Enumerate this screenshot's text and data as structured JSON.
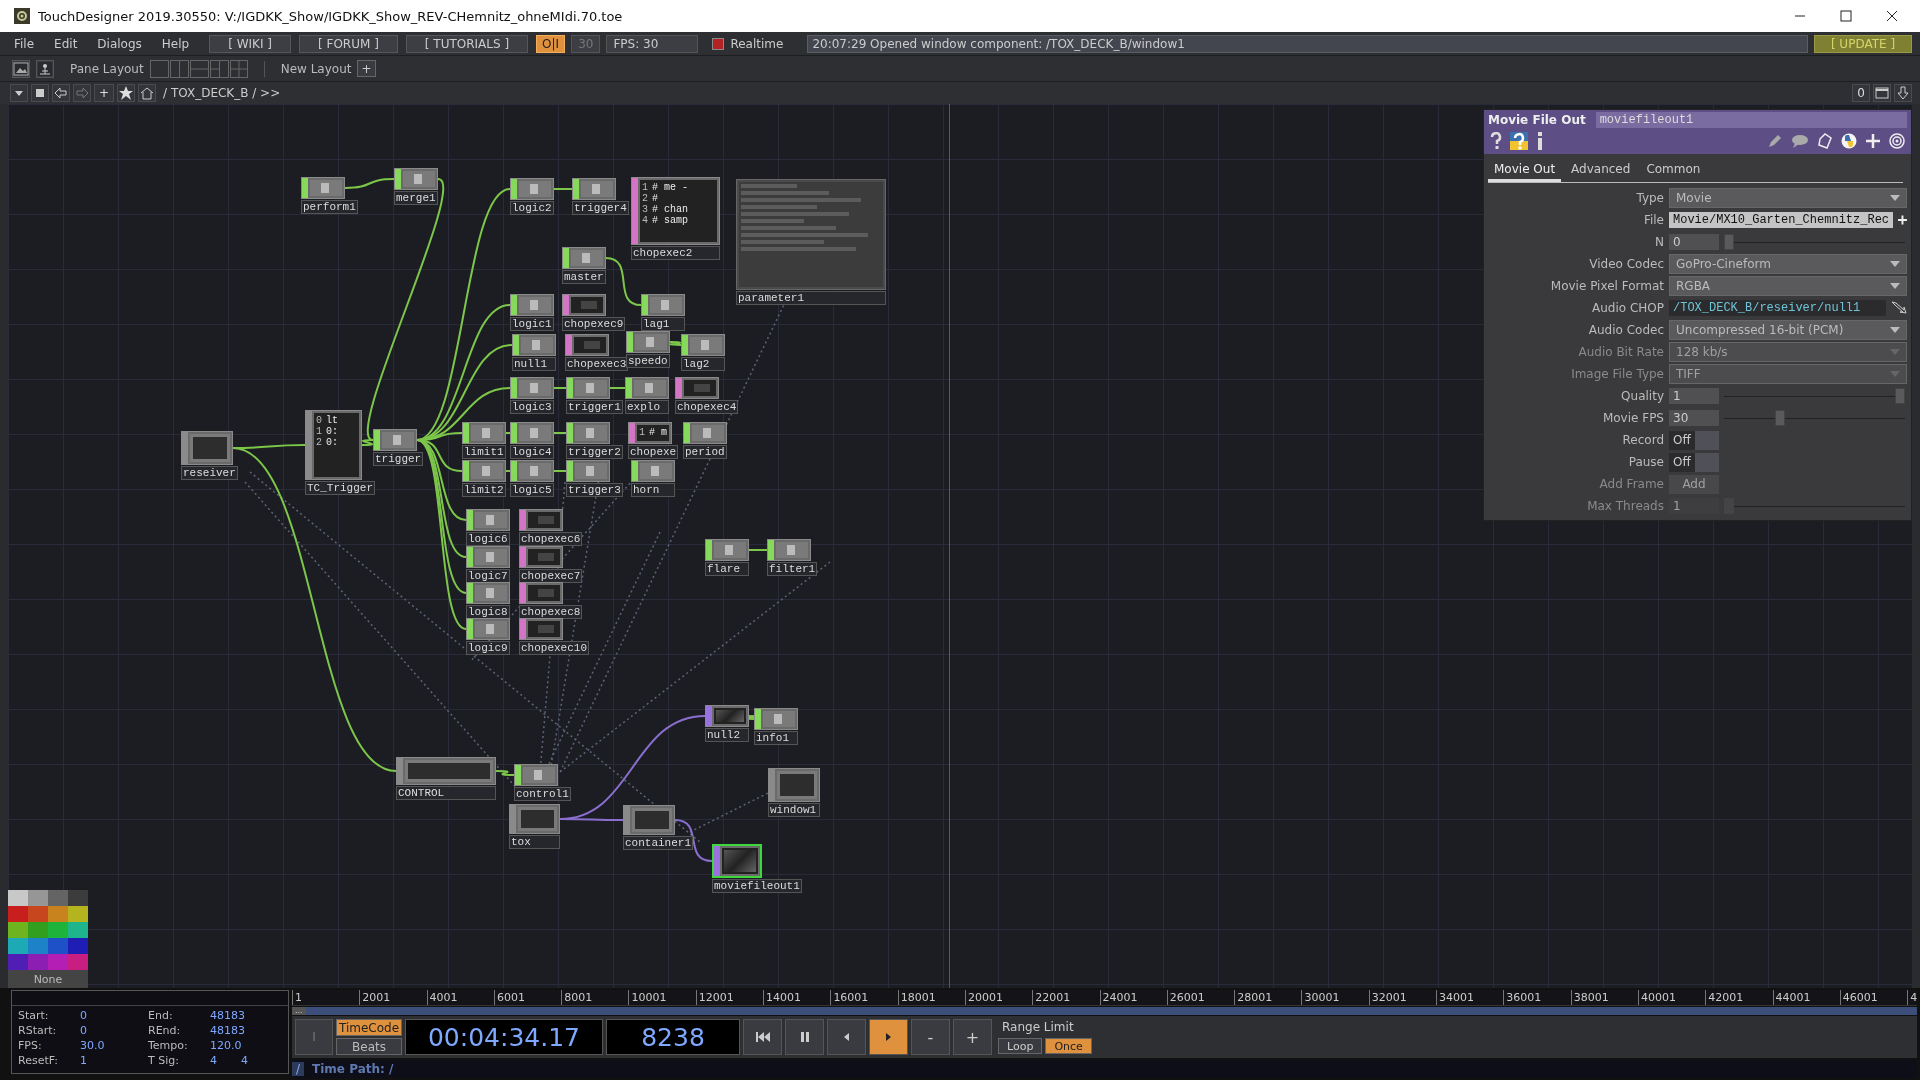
{
  "window": {
    "title": "TouchDesigner 2019.30550: V:/IGDKK_Show/IGDKK_Show_REV-CHemnitz_ohneMIdi.70.toe"
  },
  "menu": [
    "File",
    "Edit",
    "Dialogs",
    "Help"
  ],
  "links": [
    "[ WIKI ]",
    "[ FORUM ]",
    "[ TUTORIALS ]"
  ],
  "toolbar": {
    "perform": {
      "label": "O|I",
      "on": true
    },
    "fps_limit": "30",
    "fps": "FPS:  30",
    "realtime": {
      "label": "Realtime",
      "on": true
    },
    "message": "20:07:29 Opened window component: /TOX_DECK_B/window1",
    "update": "[ UPDATE ]"
  },
  "pane_bar": {
    "label": "Pane Layout",
    "new_layout": "New Layout",
    "add": "+"
  },
  "path_bar": {
    "add": "+",
    "path": "/ TOX_DECK_B / >>",
    "count": "0"
  },
  "nodes": [
    {
      "name": "perform1",
      "kind": "chop",
      "selected": false
    },
    {
      "name": "merge1",
      "kind": "chop",
      "selected": false
    },
    {
      "name": "logic2",
      "kind": "chop",
      "selected": false
    },
    {
      "name": "trigger4",
      "kind": "chop",
      "selected": false
    },
    {
      "name": "chopexec2",
      "kind": "dat",
      "selected": false,
      "lines": [
        {
          "num": "1",
          "text": "# me -"
        },
        {
          "num": "2",
          "text": "#"
        },
        {
          "num": "3",
          "text": "# chan"
        },
        {
          "num": "4",
          "text": "# samp"
        }
      ]
    },
    {
      "name": "parameter1",
      "kind": "panel",
      "selected": false
    },
    {
      "name": "master",
      "kind": "chop",
      "selected": false
    },
    {
      "name": "logic1",
      "kind": "chop",
      "selected": false
    },
    {
      "name": "chopexec9",
      "kind": "dat",
      "selected": false
    },
    {
      "name": "lag1",
      "kind": "chop",
      "selected": false
    },
    {
      "name": "null1",
      "kind": "chop",
      "selected": false
    },
    {
      "name": "chopexec3",
      "kind": "dat",
      "selected": false
    },
    {
      "name": "speedo",
      "kind": "chop",
      "selected": false
    },
    {
      "name": "lag2",
      "kind": "chop",
      "selected": false
    },
    {
      "name": "logic3",
      "kind": "chop",
      "selected": false
    },
    {
      "name": "trigger1",
      "kind": "chop",
      "selected": false
    },
    {
      "name": "explo",
      "kind": "chop",
      "selected": false
    },
    {
      "name": "chopexec4",
      "kind": "dat",
      "selected": false
    },
    {
      "name": "reseiver",
      "kind": "comp",
      "selected": false
    },
    {
      "name": "TC_Trigger",
      "kind": "comp",
      "selected": false,
      "lines": [
        {
          "num": "0",
          "text": "lt"
        },
        {
          "num": "1",
          "text": "0:"
        },
        {
          "num": "2",
          "text": "0:"
        }
      ]
    },
    {
      "name": "trigger",
      "kind": "chop",
      "selected": false
    },
    {
      "name": "limit1",
      "kind": "chop",
      "selected": false
    },
    {
      "name": "logic4",
      "kind": "chop",
      "selected": false
    },
    {
      "name": "trigger2",
      "kind": "chop",
      "selected": false
    },
    {
      "name": "chopexe",
      "kind": "dat",
      "selected": false,
      "lines": [
        {
          "num": "1",
          "text": "# m"
        }
      ]
    },
    {
      "name": "period",
      "kind": "chop",
      "selected": false
    },
    {
      "name": "limit2",
      "kind": "chop",
      "selected": false
    },
    {
      "name": "logic5",
      "kind": "chop",
      "selected": false
    },
    {
      "name": "trigger3",
      "kind": "chop",
      "selected": false
    },
    {
      "name": "horn",
      "kind": "chop",
      "selected": false
    },
    {
      "name": "logic6",
      "kind": "chop",
      "selected": false
    },
    {
      "name": "chopexec6",
      "kind": "dat",
      "selected": false
    },
    {
      "name": "logic7",
      "kind": "chop",
      "selected": false
    },
    {
      "name": "chopexec7",
      "kind": "dat",
      "selected": false
    },
    {
      "name": "logic8",
      "kind": "chop",
      "selected": false
    },
    {
      "name": "chopexec8",
      "kind": "dat",
      "selected": false
    },
    {
      "name": "logic9",
      "kind": "chop",
      "selected": false
    },
    {
      "name": "chopexec10",
      "kind": "dat",
      "selected": false
    },
    {
      "name": "flare",
      "kind": "chop",
      "selected": false
    },
    {
      "name": "filter1",
      "kind": "chop",
      "selected": false
    },
    {
      "name": "null2",
      "kind": "top",
      "selected": false
    },
    {
      "name": "info1",
      "kind": "chop",
      "selected": false
    },
    {
      "name": "CONTROL",
      "kind": "comp",
      "selected": false
    },
    {
      "name": "control1",
      "kind": "chop",
      "selected": false
    },
    {
      "name": "window1",
      "kind": "comp",
      "selected": false
    },
    {
      "name": "tox",
      "kind": "comp",
      "selected": false
    },
    {
      "name": "container1",
      "kind": "comp",
      "selected": false
    },
    {
      "name": "moviefileout1",
      "kind": "top",
      "selected": true
    }
  ],
  "parameters": {
    "operator_type": "Movie File Out",
    "name": "moviefileout1",
    "tabs": [
      {
        "label": "Movie Out",
        "selected": true
      },
      {
        "label": "Advanced",
        "selected": false
      },
      {
        "label": "Common",
        "selected": false
      }
    ],
    "rows": [
      {
        "label": "Type",
        "kind": "menu",
        "value": "Movie",
        "disabled": false
      },
      {
        "label": "File",
        "kind": "file",
        "value": "Movie/MX10_Garten_Chemnitz_Rec",
        "disabled": false
      },
      {
        "label": "N",
        "kind": "slider",
        "value": "0",
        "level": 0.0,
        "disabled": false
      },
      {
        "label": "Video Codec",
        "kind": "menu",
        "value": "GoPro-Cineform",
        "disabled": false
      },
      {
        "label": "Movie Pixel Format",
        "kind": "menu",
        "value": "RGBA",
        "disabled": false
      },
      {
        "label": "Audio CHOP",
        "kind": "path",
        "value": "/TOX_DECK_B/reseiver/null1",
        "disabled": false
      },
      {
        "label": "Audio Codec",
        "kind": "menu",
        "value": "Uncompressed 16-bit (PCM)",
        "disabled": false
      },
      {
        "label": "Audio Bit Rate",
        "kind": "menu",
        "value": "128 kb/s",
        "disabled": true
      },
      {
        "label": "Image File Type",
        "kind": "menu",
        "value": "TIFF",
        "disabled": true
      },
      {
        "label": "Quality",
        "kind": "slider",
        "value": "1",
        "level": 1.0,
        "disabled": false
      },
      {
        "label": "Movie FPS",
        "kind": "slider",
        "value": "30",
        "level": 0.3,
        "disabled": false
      },
      {
        "label": "Record",
        "kind": "toggle",
        "value": "Off",
        "on": false,
        "disabled": false
      },
      {
        "label": "Pause",
        "kind": "toggle",
        "value": "Off",
        "on": false,
        "disabled": false
      },
      {
        "label": "Add Frame",
        "kind": "button",
        "value": "Add",
        "disabled": true
      },
      {
        "label": "Max Threads",
        "kind": "slider",
        "value": "1",
        "level": 0.0,
        "disabled": true
      }
    ]
  },
  "palette": {
    "colors": [
      {
        "color": "#c8c8c8"
      },
      {
        "color": "#969696"
      },
      {
        "color": "#646464"
      },
      {
        "color": "#3c3c3c"
      },
      {
        "color": "#c81e1e"
      },
      {
        "color": "#c8461e"
      },
      {
        "color": "#c8821e"
      },
      {
        "color": "#b4b41e"
      },
      {
        "color": "#6eb41e"
      },
      {
        "color": "#32a01e"
      },
      {
        "color": "#1eb43c"
      },
      {
        "color": "#1eb48c"
      },
      {
        "color": "#1eaab4"
      },
      {
        "color": "#1e82c8"
      },
      {
        "color": "#1e50c8"
      },
      {
        "color": "#1e1eb4"
      },
      {
        "color": "#501eb4"
      },
      {
        "color": "#8c1eb4"
      },
      {
        "color": "#b41eb4"
      },
      {
        "color": "#c81e82"
      }
    ],
    "none": "None"
  },
  "info": [
    {
      "label": "Start:",
      "values": [
        "0"
      ]
    },
    {
      "label": "End:",
      "values": [
        "48183"
      ]
    },
    {
      "label": "RStart:",
      "values": [
        "0"
      ]
    },
    {
      "label": "REnd:",
      "values": [
        "48183"
      ]
    },
    {
      "label": "FPS:",
      "values": [
        "30.0"
      ]
    },
    {
      "label": "Tempo:",
      "values": [
        "120.0"
      ]
    },
    {
      "label": "ResetF:",
      "values": [
        "1"
      ]
    },
    {
      "label": "T Sig:",
      "values": [
        "4",
        "4"
      ]
    }
  ],
  "timeline": {
    "ticks": [
      "1",
      "2001",
      "4001",
      "6001",
      "8001",
      "10001",
      "12001",
      "14001",
      "16001",
      "18001",
      "20001",
      "22001",
      "24001",
      "26001",
      "28001",
      "30001",
      "32001",
      "34001",
      "36001",
      "38001",
      "40001",
      "42001",
      "44001",
      "46001",
      "4"
    ],
    "range_handle": "...",
    "side_button": "I",
    "modes": [
      {
        "label": "TimeCode",
        "selected": true
      },
      {
        "label": "Beats",
        "selected": false
      }
    ],
    "timecode": "00:04:34.17",
    "frame": "8238",
    "transport": [
      {
        "kind": "rewind",
        "selected": false
      },
      {
        "kind": "pause",
        "selected": false
      },
      {
        "kind": "back",
        "selected": false
      },
      {
        "kind": "play",
        "selected": true
      },
      {
        "kind": "text",
        "label": "-",
        "selected": false
      },
      {
        "kind": "text",
        "label": "+",
        "selected": false
      }
    ],
    "range_label": "Range Limit",
    "range_modes": [
      {
        "label": "Loop",
        "selected": false
      },
      {
        "label": "Once",
        "selected": true
      }
    ],
    "root": "/",
    "time_path": "Time Path: /"
  }
}
